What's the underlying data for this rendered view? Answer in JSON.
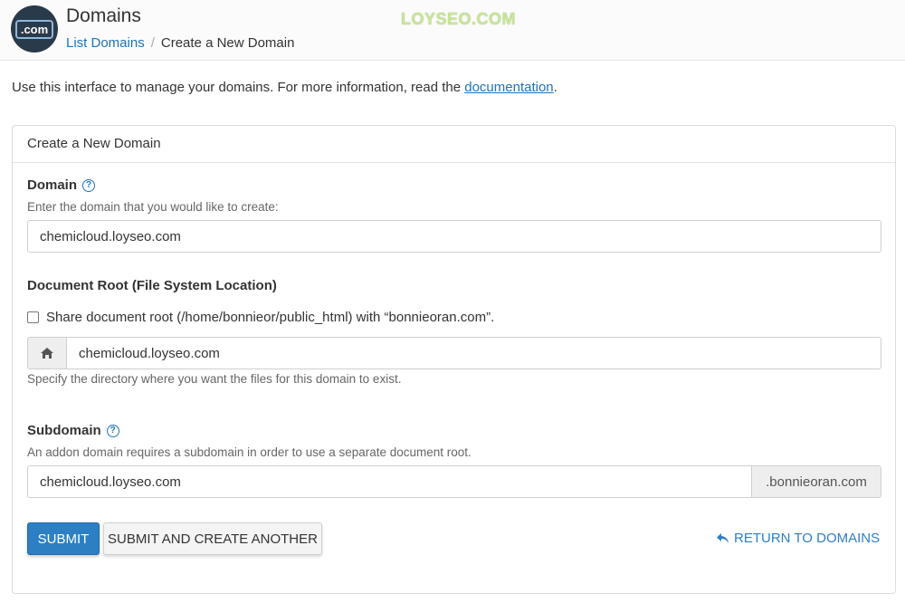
{
  "header": {
    "logo_text": ".com",
    "title": "Domains",
    "watermark": "LOYSEO.COM",
    "breadcrumb": {
      "link": "List Domains",
      "separator": "/",
      "current": "Create a New Domain"
    }
  },
  "intro": {
    "text": "Use this interface to manage your domains. For more information, read the ",
    "link": "documentation",
    "end": "."
  },
  "panel": {
    "heading": "Create a New Domain",
    "domain": {
      "label": "Domain",
      "hint": "Enter the domain that you would like to create:",
      "value": "chemicloud.loyseo.com"
    },
    "document_root": {
      "label": "Document Root (File System Location)",
      "checkbox_label": "Share document root (/home/bonnieor/public_html) with “bonnieoran.com”.",
      "checked": false,
      "value": "chemicloud.loyseo.com",
      "hint": "Specify the directory where you want the files for this domain to exist.",
      "icon": "home-icon"
    },
    "subdomain": {
      "label": "Subdomain",
      "hint": "An addon domain requires a subdomain in order to use a separate document root.",
      "value": "chemicloud.loyseo.com",
      "suffix": ".bonnieoran.com"
    },
    "buttons": {
      "submit": "SUBMIT",
      "submit_another": "SUBMIT AND CREATE ANOTHER",
      "return": "RETURN TO DOMAINS"
    }
  },
  "colors": {
    "accent": "#2d7fc4",
    "link": "#1f73b7",
    "logo_bg": "#293a4a"
  }
}
